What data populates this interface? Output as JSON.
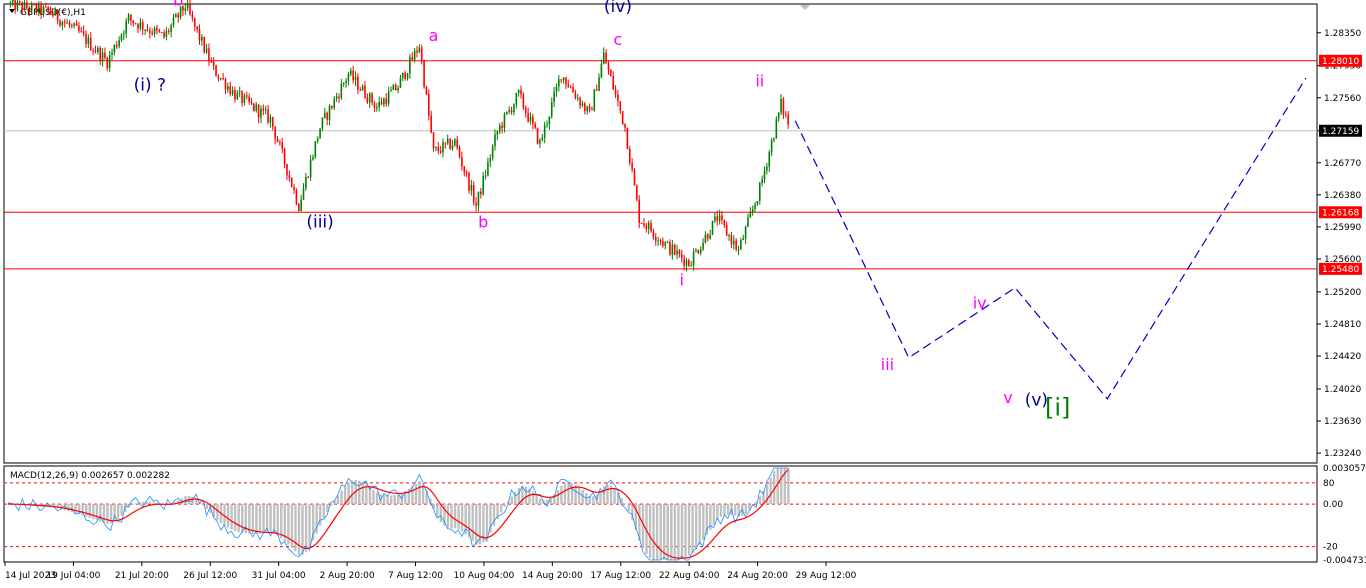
{
  "symbol": "GBPUSD(€),H1",
  "chart_data": [
    {
      "type": "candlestick",
      "symbol": "GBPUSD(€),H1",
      "timeframe": "H1",
      "ylim": [
        1.2312,
        1.287
      ],
      "y_ticks": [
        "1.28350",
        "1.27950",
        "1.27560",
        "1.27159",
        "1.26770",
        "1.26380",
        "1.25990",
        "1.25600",
        "1.25200",
        "1.24810",
        "1.24420",
        "1.24020",
        "1.23630",
        "1.23240"
      ],
      "x_ticks": [
        "14 Jul 2023",
        "19 Jul 04:00",
        "21 Jul 20:00",
        "26 Jul 12:00",
        "31 Jul 04:00",
        "2 Aug 20:00",
        "7 Aug 12:00",
        "10 Aug 04:00",
        "14 Aug 20:00",
        "17 Aug 12:00",
        "22 Aug 04:00",
        "24 Aug 20:00",
        "29 Aug 12:00"
      ],
      "horizontal_levels": [
        {
          "label": "1.28010",
          "value": 1.2801,
          "color": "#ff0000"
        },
        {
          "label": "1.27159",
          "value": 1.27159,
          "color": "#c0c0c0"
        },
        {
          "label": "1.26168",
          "value": 1.26168,
          "color": "#ff0000"
        },
        {
          "label": "1.25480",
          "value": 1.2548,
          "color": "#ff0000"
        }
      ],
      "price_path": [
        {
          "t": 0,
          "p": 1.287
        },
        {
          "t": 6,
          "p": 1.286
        },
        {
          "t": 10,
          "p": 1.2835
        },
        {
          "t": 14,
          "p": 1.28
        },
        {
          "t": 17,
          "p": 1.2852
        },
        {
          "t": 22,
          "p": 1.283
        },
        {
          "t": 25,
          "p": 1.2868
        },
        {
          "t": 29,
          "p": 1.279
        },
        {
          "t": 32,
          "p": 1.276
        },
        {
          "t": 37,
          "p": 1.273
        },
        {
          "t": 41,
          "p": 1.2625
        },
        {
          "t": 44,
          "p": 1.272
        },
        {
          "t": 48,
          "p": 1.2785
        },
        {
          "t": 52,
          "p": 1.2745
        },
        {
          "t": 55,
          "p": 1.277
        },
        {
          "t": 58,
          "p": 1.282
        },
        {
          "t": 60,
          "p": 1.269
        },
        {
          "t": 63,
          "p": 1.2702
        },
        {
          "t": 66,
          "p": 1.2625
        },
        {
          "t": 69,
          "p": 1.2715
        },
        {
          "t": 72,
          "p": 1.276
        },
        {
          "t": 75,
          "p": 1.27
        },
        {
          "t": 78,
          "p": 1.2785
        },
        {
          "t": 82,
          "p": 1.2735
        },
        {
          "t": 84,
          "p": 1.2808
        },
        {
          "t": 87,
          "p": 1.272
        },
        {
          "t": 89,
          "p": 1.261
        },
        {
          "t": 93,
          "p": 1.2575
        },
        {
          "t": 96,
          "p": 1.2555
        },
        {
          "t": 100,
          "p": 1.261
        },
        {
          "t": 103,
          "p": 1.257
        },
        {
          "t": 106,
          "p": 1.2645
        },
        {
          "t": 109,
          "p": 1.2748
        },
        {
          "t": 110,
          "p": 1.2725
        }
      ],
      "projection": [
        {
          "t": 111,
          "p": 1.2728
        },
        {
          "t": 127,
          "p": 1.244
        },
        {
          "t": 142,
          "p": 1.2525
        },
        {
          "t": 155,
          "p": 1.239
        },
        {
          "t": 183,
          "p": 1.278
        }
      ],
      "wave_labels": [
        {
          "text": "b",
          "t": 24,
          "p": 1.2868,
          "color": "#ff00ff"
        },
        {
          "text": "(i) ?",
          "t": 20,
          "p": 1.2765,
          "color": "#00008b"
        },
        {
          "text": "a",
          "t": 60,
          "p": 1.2825,
          "color": "#ff00ff"
        },
        {
          "text": "(iv)",
          "t": 86,
          "p": 1.286,
          "color": "#00008b"
        },
        {
          "text": "c",
          "t": 86,
          "p": 1.282,
          "color": "#ff00ff"
        },
        {
          "text": "(iii)",
          "t": 44,
          "p": 1.2598,
          "color": "#00008b"
        },
        {
          "text": "b",
          "t": 67,
          "p": 1.2598,
          "color": "#ff00ff"
        },
        {
          "text": "ii",
          "t": 106,
          "p": 1.277,
          "color": "#ff00ff"
        },
        {
          "text": "i",
          "t": 95,
          "p": 1.2528,
          "color": "#ff00ff"
        },
        {
          "text": "iv",
          "t": 137,
          "p": 1.25,
          "color": "#ff00ff"
        },
        {
          "text": "iii",
          "t": 124,
          "p": 1.2425,
          "color": "#ff00ff"
        },
        {
          "text": "v",
          "t": 141,
          "p": 1.2385,
          "color": "#ff00ff"
        },
        {
          "text": "(v)",
          "t": 145,
          "p": 1.2382,
          "color": "#00008b"
        },
        {
          "text": "[i]",
          "t": 148,
          "p": 1.237,
          "color": "#008000"
        }
      ],
      "colors": {
        "up": "#008000",
        "down": "#ff0000",
        "projection": "#0000cd"
      }
    },
    {
      "type": "macd",
      "title": "MACD(12,26,9) 0.002657 0.002282",
      "params": "12,26,9",
      "main": 0.002657,
      "signal": 0.002282,
      "ylim": [
        -0.004731,
        0.003057
      ],
      "y_ticks": [
        "0.003057",
        "80",
        "0.00",
        "-20",
        "-0.004731"
      ],
      "levels": [
        {
          "label": "80",
          "value": 0.0018
        },
        {
          "label": "0.00",
          "value": 0.0
        },
        {
          "label": "-20",
          "value": -0.0036
        }
      ],
      "colors": {
        "histogram": "#c0c0c0",
        "signal": "#ff0000",
        "main": "#1e90ff"
      }
    }
  ]
}
